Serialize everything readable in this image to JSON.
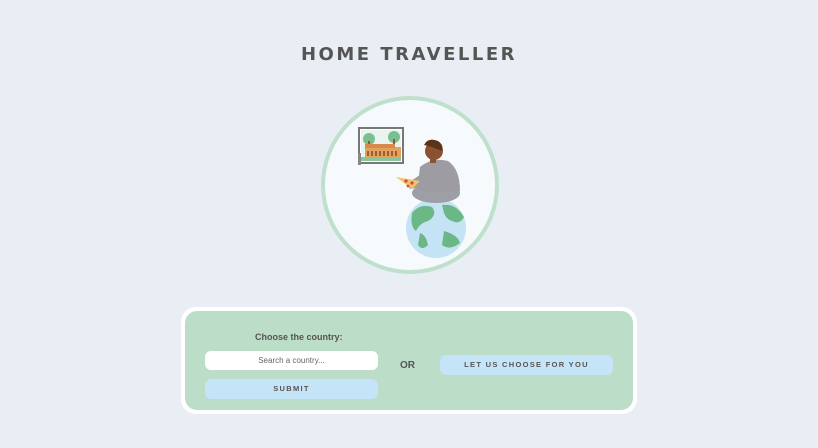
{
  "header": {
    "title": "HOME TRAVELLER"
  },
  "form": {
    "choose_label": "Choose the country:",
    "search_placeholder": "Search a country...",
    "submit_label": "SUBMIT",
    "or_label": "OR",
    "random_label": "LET US CHOOSE FOR YOU"
  },
  "colors": {
    "background": "#e8eef4",
    "panel": "#bcddc7",
    "button": "#c6e4f7",
    "text": "#555555"
  },
  "hero": {
    "icon": "traveller-on-globe-illustration"
  }
}
